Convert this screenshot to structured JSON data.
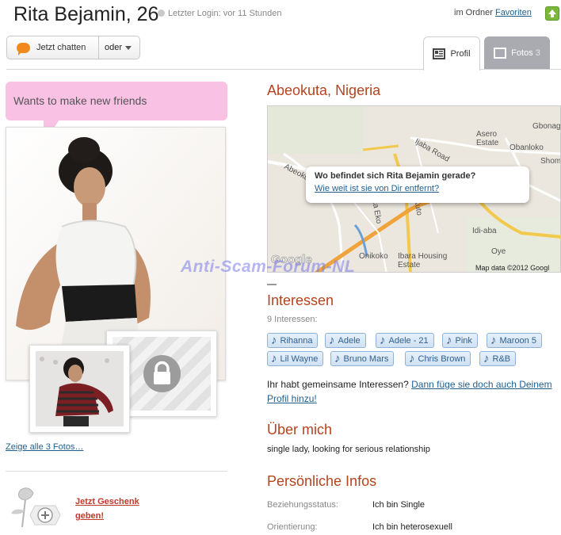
{
  "header": {
    "name_age": "Rita Bejamin, 26",
    "last_login": "Letzter Login: vor 11 Stunden",
    "folder_prefix": "im Ordner",
    "folder_link": "Favoriten"
  },
  "actions": {
    "chat_label": "Jetzt chatten",
    "oder_label": "oder"
  },
  "tabs": {
    "profil": "Profil",
    "fotos": "Fotos",
    "fotos_count": "3"
  },
  "status_message": "Wants to make new friends",
  "photos": {
    "show_all": "Zeige alle 3 Fotos…"
  },
  "gift": {
    "line1": "Jetzt Geschenk",
    "line2": "geben!"
  },
  "location": "Abeokuta, Nigeria",
  "map": {
    "popup_question": "Wo befindet sich Rita Bejamin gerade?",
    "popup_link": "Wie weit ist sie von Dir entfernt?",
    "labels": {
      "asero_estate": "Asero\nEstate",
      "gbonga": "Gbonag",
      "obanloko": "Obanloko",
      "shom": "Shom",
      "abeokuta": "Abeokuta",
      "ijaba_road": "Ijaba Road",
      "ita_eko": "Ita Eko",
      "kuto": "Kuto",
      "idi_aba": "Idi-aba",
      "oye": "Oye",
      "onikoko": "Onikoko",
      "ibara": "Ibara Housing\nEstate"
    },
    "google": "Google",
    "copyright": "Map data ©2012 Googl"
  },
  "interests": {
    "title": "Interessen",
    "count": "9 Interessen:",
    "tags": [
      "Rihanna",
      "Adele",
      "Adele - 21",
      "Pink",
      "Maroon 5",
      "Lil Wayne",
      "Bruno Mars",
      "Chris Brown",
      "R&B"
    ]
  },
  "common": {
    "question": "Ihr habt gemeinsame Interessen?",
    "link": "Dann füge sie doch auch Deinem Profil hinzu!"
  },
  "about": {
    "title": "Über mich",
    "text": "single lady, looking for serious relationship"
  },
  "infos": {
    "title": "Persönliche Infos",
    "rows": [
      {
        "label": "Beziehungsstatus:",
        "value": "Ich bin Single"
      },
      {
        "label": "Orientierung:",
        "value": "Ich bin heterosexuell"
      }
    ]
  },
  "watermark": "Anti-Scam-Forum-NL",
  "colors": {
    "accent_title": "#b5431e",
    "link": "#1f5f8f",
    "status_bg": "#f9c1e4",
    "tag_bg": "#cfe1f3"
  }
}
